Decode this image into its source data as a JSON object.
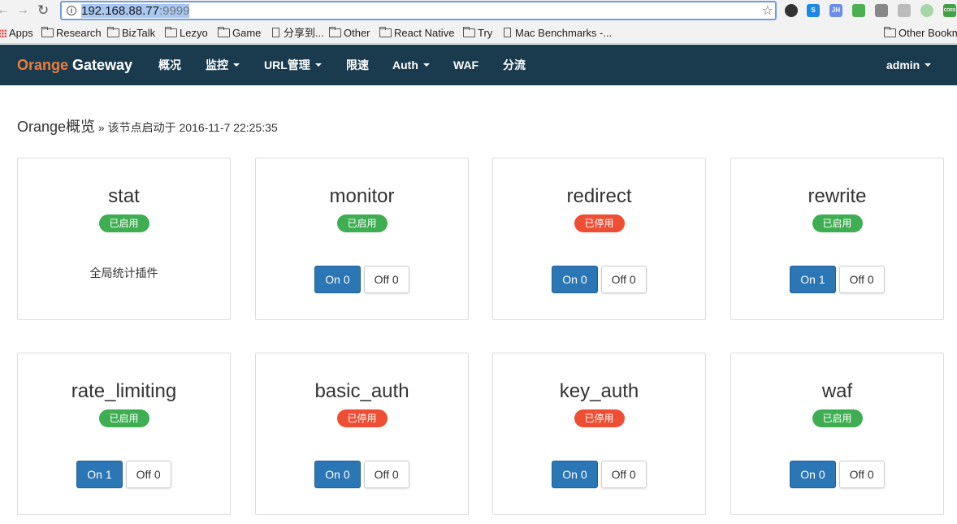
{
  "browser": {
    "url_host": "192.168.88.77",
    "url_port": ":9999",
    "bookmarks": [
      {
        "label": "Apps",
        "icon": "apps-grid-icon"
      },
      {
        "label": "Research",
        "icon": "folder-icon"
      },
      {
        "label": "BizTalk",
        "icon": "folder-icon"
      },
      {
        "label": "Lezyo",
        "icon": "folder-icon"
      },
      {
        "label": "Game",
        "icon": "folder-icon"
      },
      {
        "label": "分享到...",
        "icon": "page-icon"
      },
      {
        "label": "Other",
        "icon": "folder-icon"
      },
      {
        "label": "React Native",
        "icon": "folder-icon"
      },
      {
        "label": "Try",
        "icon": "folder-icon"
      },
      {
        "label": "Mac Benchmarks -...",
        "icon": "page-icon"
      },
      {
        "label": "Other Bookm",
        "icon": "folder-icon"
      }
    ],
    "extensions": [
      {
        "icon": "ghost-extension-icon",
        "color": "#333333",
        "text": ""
      },
      {
        "icon": "s-extension-icon",
        "color": "#1e88e5",
        "text": "S"
      },
      {
        "icon": "jh-extension-icon",
        "color": "#6c8ee8",
        "text": "JH"
      },
      {
        "icon": "puzzle-extension-icon",
        "color": "#4caf50",
        "text": ""
      },
      {
        "icon": "qr-extension-icon",
        "color": "#888888",
        "text": ""
      },
      {
        "icon": "plant-extension-icon",
        "color": "#bbbbbb",
        "text": ""
      },
      {
        "icon": "circle-extension-icon",
        "color": "#a5d6a7",
        "text": ""
      },
      {
        "icon": "cors-extension-icon",
        "color": "#43a047",
        "text": "CORS"
      }
    ]
  },
  "navbar": {
    "brand_highlight": "Orange",
    "brand_rest": " Gateway",
    "items": [
      {
        "label": "概况",
        "dropdown": false
      },
      {
        "label": "监控",
        "dropdown": true
      },
      {
        "label": "URL管理",
        "dropdown": true
      },
      {
        "label": "限速",
        "dropdown": false
      },
      {
        "label": "Auth",
        "dropdown": true
      },
      {
        "label": "WAF",
        "dropdown": false
      },
      {
        "label": "分流",
        "dropdown": false
      }
    ],
    "user": "admin"
  },
  "page": {
    "title": "Orange概览",
    "subtitle": " » 该节点启动于 2016-11-7 22:25:35"
  },
  "colors": {
    "enabled": "#3fae52",
    "disabled": "#ee4e33",
    "navbar": "#1a3a4d",
    "brand": "#ee7d3b",
    "button_primary": "#2b76b4"
  },
  "plugins": [
    {
      "name": "stat",
      "status": "已启用",
      "enabled": true,
      "description": "全局统计插件"
    },
    {
      "name": "monitor",
      "status": "已启用",
      "enabled": true,
      "on": "On 0",
      "off": "Off 0"
    },
    {
      "name": "redirect",
      "status": "已停用",
      "enabled": false,
      "on": "On 0",
      "off": "Off 0"
    },
    {
      "name": "rewrite",
      "status": "已启用",
      "enabled": true,
      "on": "On 1",
      "off": "Off 0"
    },
    {
      "name": "rate_limiting",
      "status": "已启用",
      "enabled": true,
      "on": "On 1",
      "off": "Off 0"
    },
    {
      "name": "basic_auth",
      "status": "已停用",
      "enabled": false,
      "on": "On 0",
      "off": "Off 0"
    },
    {
      "name": "key_auth",
      "status": "已停用",
      "enabled": false,
      "on": "On 0",
      "off": "Off 0"
    },
    {
      "name": "waf",
      "status": "已启用",
      "enabled": true,
      "on": "On 0",
      "off": "Off 0"
    }
  ]
}
